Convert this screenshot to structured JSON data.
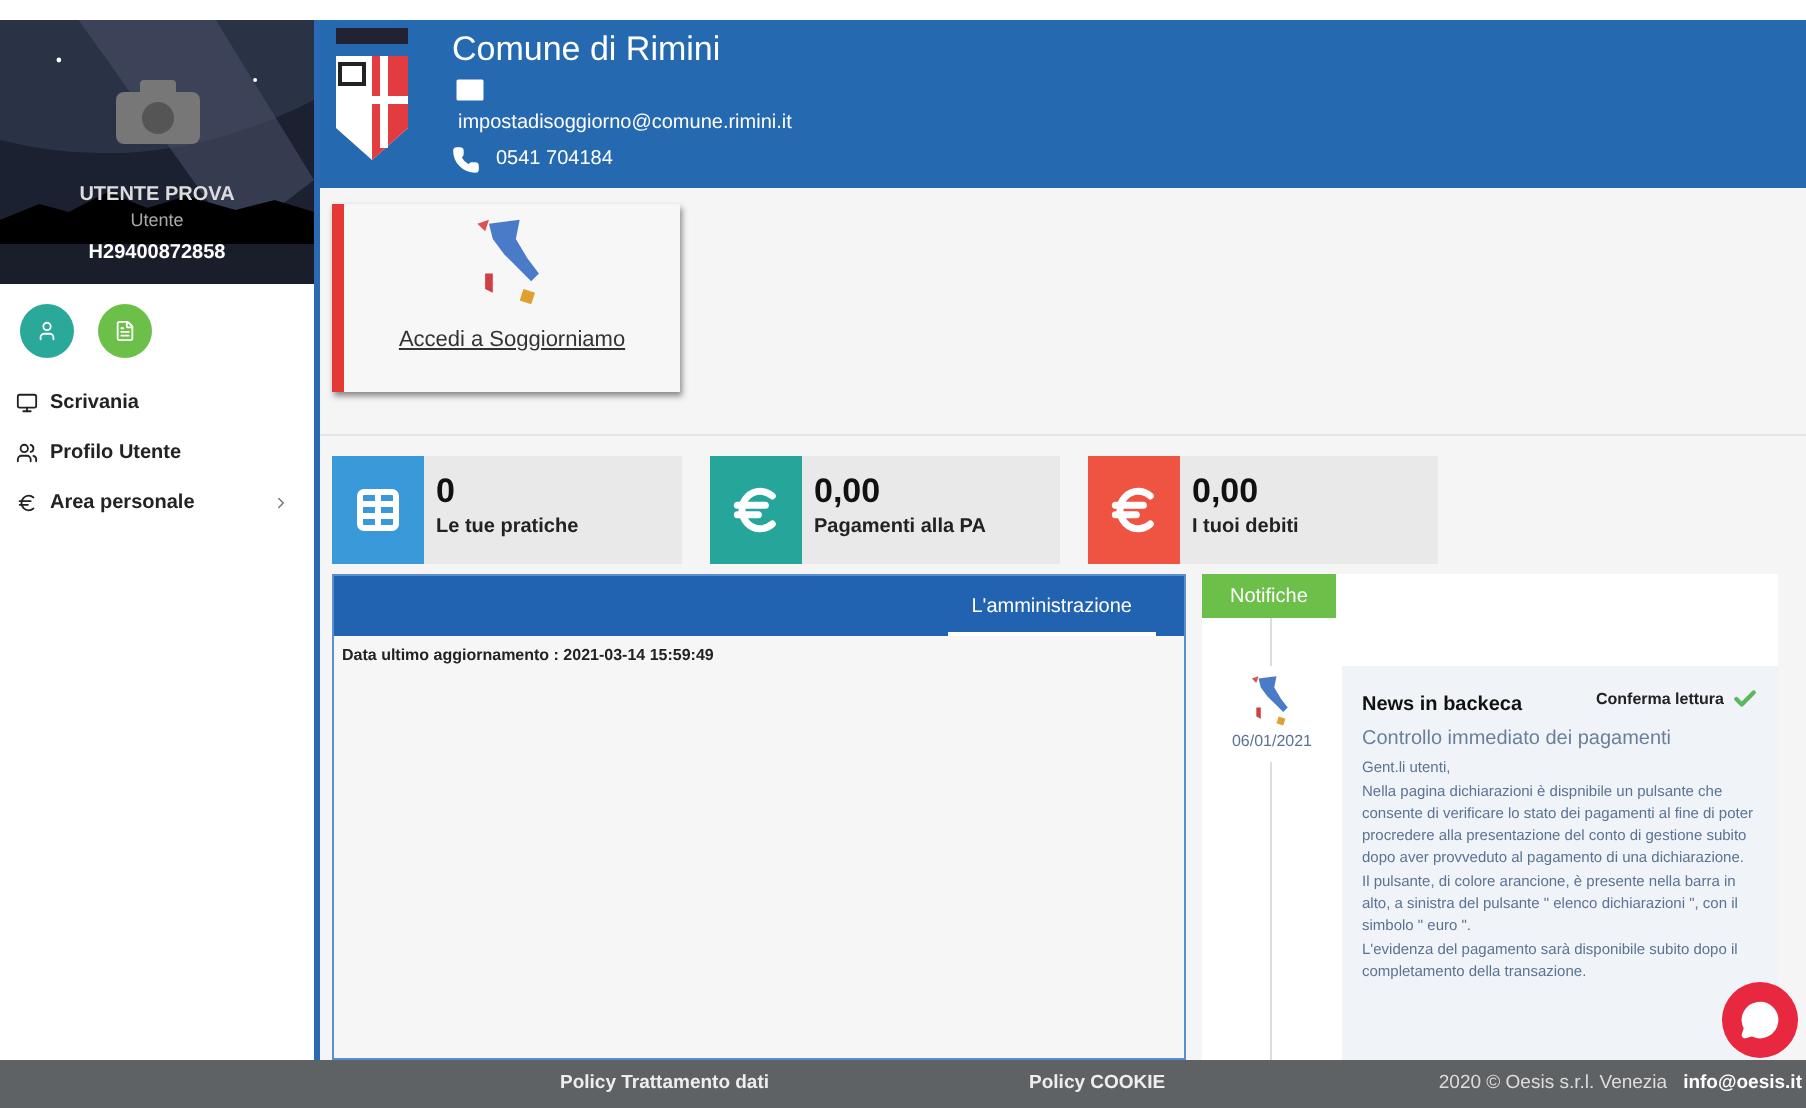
{
  "header": {
    "title": "Comune di Rimini",
    "email": "impostadisoggiorno@comune.rimini.it",
    "phone": "0541 704184"
  },
  "profile": {
    "name": "UTENTE PROVA",
    "role": "Utente",
    "code": "H29400872858"
  },
  "quick_buttons": [
    {
      "kind": "user",
      "color": "#2aa899"
    },
    {
      "kind": "doc",
      "color": "#6cc04a"
    }
  ],
  "nav": [
    {
      "kind": "desktop",
      "label": "Scrivania",
      "expandable": false
    },
    {
      "kind": "users",
      "label": "Profilo Utente",
      "expandable": false
    },
    {
      "kind": "euro",
      "label": "Area personale",
      "expandable": true
    }
  ],
  "link_card": {
    "label": "Accedi a Soggiorniamo"
  },
  "stats": [
    {
      "kind": "table",
      "value": "0",
      "label": "Le tue pratiche",
      "color": "#3a9ad9"
    },
    {
      "kind": "euro",
      "value": "0,00",
      "label": "Pagamenti alla PA",
      "color": "#26a69a"
    },
    {
      "kind": "euro",
      "value": "0,00",
      "label": "I tuoi debiti",
      "color": "#ef5341"
    }
  ],
  "admin": {
    "tabs": [
      {
        "label": "L'amministrazione",
        "selected": true
      }
    ],
    "updated": "Data ultimo aggiornamento : 2021-03-14 15:59:49"
  },
  "notifications": {
    "tabs": [
      {
        "label": "Notifiche",
        "selected": true
      }
    ],
    "items": [
      {
        "date": "06/01/2021",
        "title": "News in backeca",
        "confirm": "Conferma lettura",
        "subtitle": "Controllo immediato dei pagamenti",
        "paragraphs": [
          "Gent.li utenti,",
          "Nella pagina dichiarazioni è dispnibile un pulsante che consente di verificare lo stato dei pagamenti al fine di  poter procredere alla presentazione del conto di gestione subito dopo aver provveduto al pagamento di una dichiarazione.",
          "Il pulsante, di colore arancione, è presente nella barra in alto, a sinistra del pulsante \" elenco dichiarazioni \", con il simbolo \" euro \".",
          "L'evidenza del pagamento sarà disponibile subito dopo il completamento della transazione."
        ]
      }
    ]
  },
  "footer": {
    "links": [
      "Policy Trattamento dati",
      "Policy COOKIE"
    ],
    "copyright": "2020 © Oesis s.r.l. Venezia",
    "email": "info@oesis.it"
  }
}
